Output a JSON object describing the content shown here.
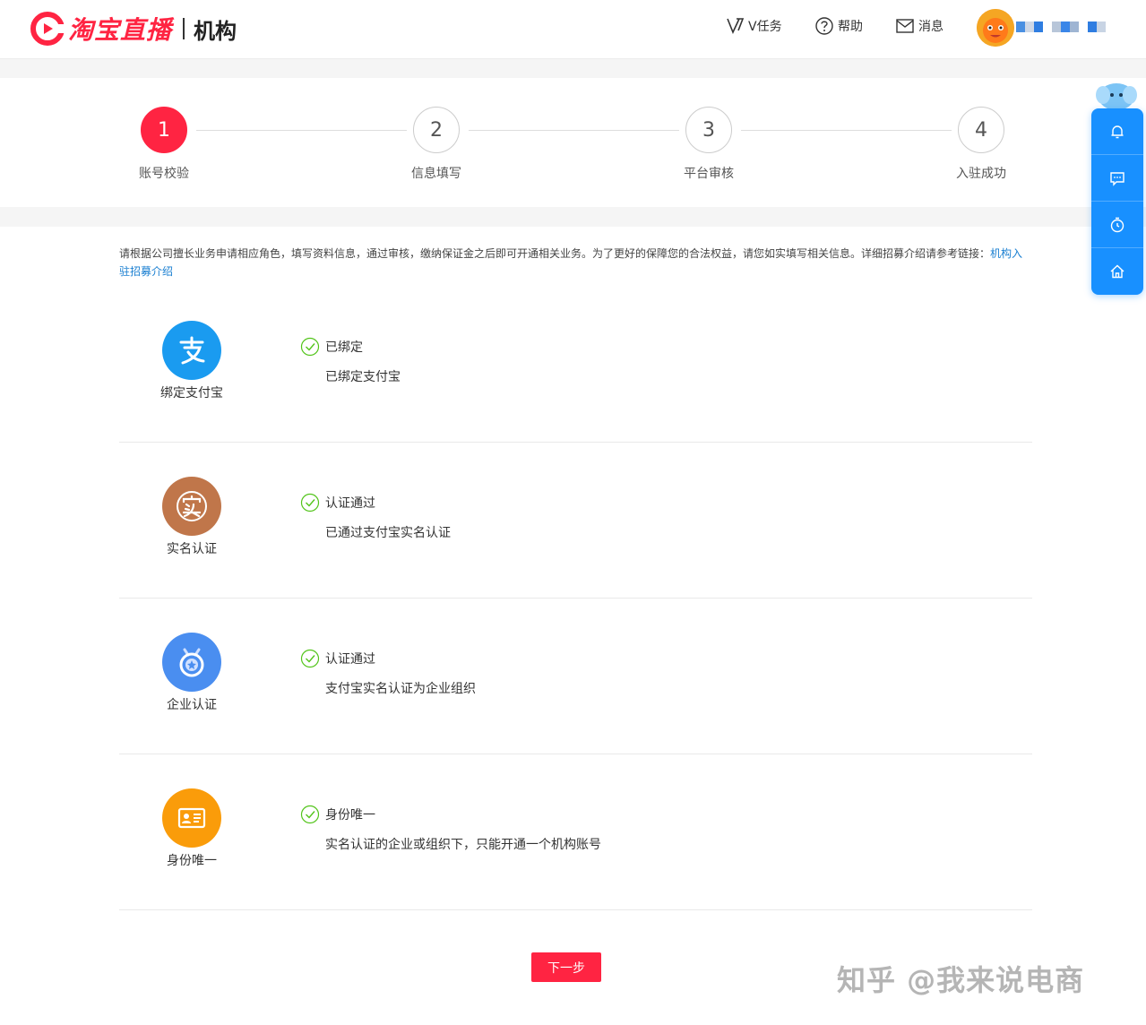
{
  "header": {
    "logo_text": "淘宝直播",
    "logo_sub": "机构",
    "nav": {
      "vtask": "V任务",
      "help": "帮助",
      "message": "消息"
    }
  },
  "steps": [
    {
      "number": "1",
      "label": "账号校验",
      "active": true
    },
    {
      "number": "2",
      "label": "信息填写",
      "active": false
    },
    {
      "number": "3",
      "label": "平台审核",
      "active": false
    },
    {
      "number": "4",
      "label": "入驻成功",
      "active": false
    }
  ],
  "intro": {
    "text": "请根据公司擅长业务申请相应角色，填写资料信息，通过审核，缴纳保证金之后即可开通相关业务。为了更好的保障您的合法权益，请您如实填写相关信息。详细招募介绍请参考链接：",
    "link_text": "机构入驻招募介绍"
  },
  "items": [
    {
      "name": "绑定支付宝",
      "status": "已绑定",
      "desc": "已绑定支付宝",
      "icon": "alipay-icon",
      "color": "#1a9bf0"
    },
    {
      "name": "实名认证",
      "status": "认证通过",
      "desc": "已通过支付宝实名认证",
      "icon": "realname-icon",
      "color": "#c0764a"
    },
    {
      "name": "企业认证",
      "status": "认证通过",
      "desc": "支付宝实名认证为企业组织",
      "icon": "enterprise-badge-icon",
      "color": "#4a8ef0"
    },
    {
      "name": "身份唯一",
      "status": "身份唯一",
      "desc": "实名认证的企业或组织下，只能开通一个机构账号",
      "icon": "id-card-icon",
      "color": "#fa9c0a"
    }
  ],
  "next_button": "下一步",
  "watermark": "知乎 @我来说电商",
  "colors": {
    "brand_red": "#ff2442",
    "float_blue": "#1890ff",
    "check_green": "#52c41a"
  },
  "float_bar": [
    "bell-icon",
    "chat-icon",
    "timer-icon",
    "home-icon"
  ]
}
